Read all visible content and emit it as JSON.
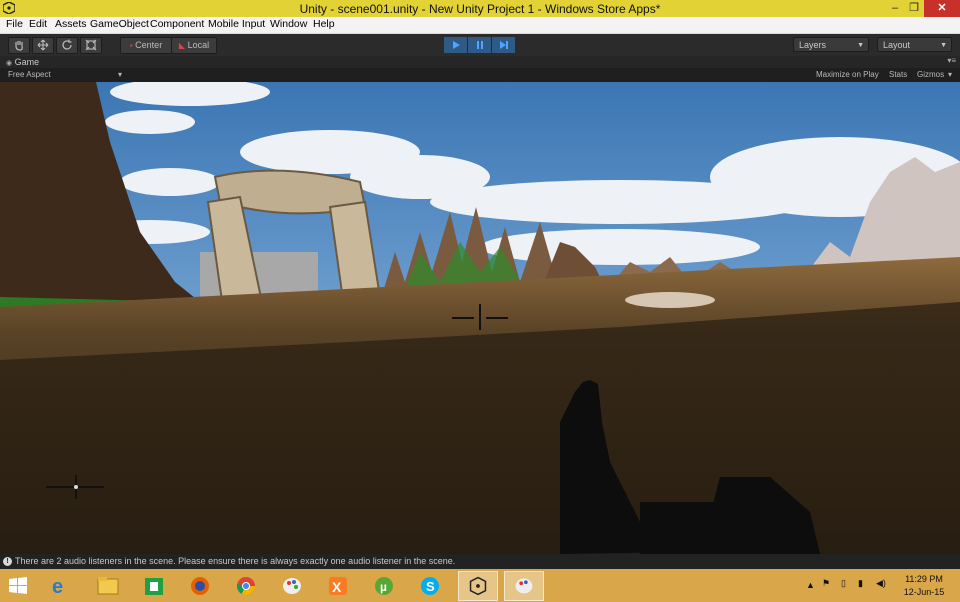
{
  "window": {
    "title": "Unity - scene001.unity - New Unity Project 1 - Windows Store Apps*",
    "minimize": "–",
    "maximize": "❐",
    "close": "✕"
  },
  "menu": [
    "File",
    "Edit",
    "Assets",
    "GameObject",
    "Component",
    "Mobile Input",
    "Window",
    "Help"
  ],
  "toolbar": {
    "pivot_label": "Center",
    "space_label": "Local",
    "layers_label": "Layers",
    "layout_label": "Layout"
  },
  "tab": {
    "label": "Game"
  },
  "game": {
    "aspect": "Free Aspect",
    "maximize_on_play": "Maximize on Play",
    "stats": "Stats",
    "gizmos": "Gizmos"
  },
  "status": {
    "message": "There are 2 audio listeners in the scene. Please ensure there is always exactly one audio listener in the scene."
  },
  "clock": {
    "time": "11:29 PM",
    "date": "12-Jun-15"
  }
}
